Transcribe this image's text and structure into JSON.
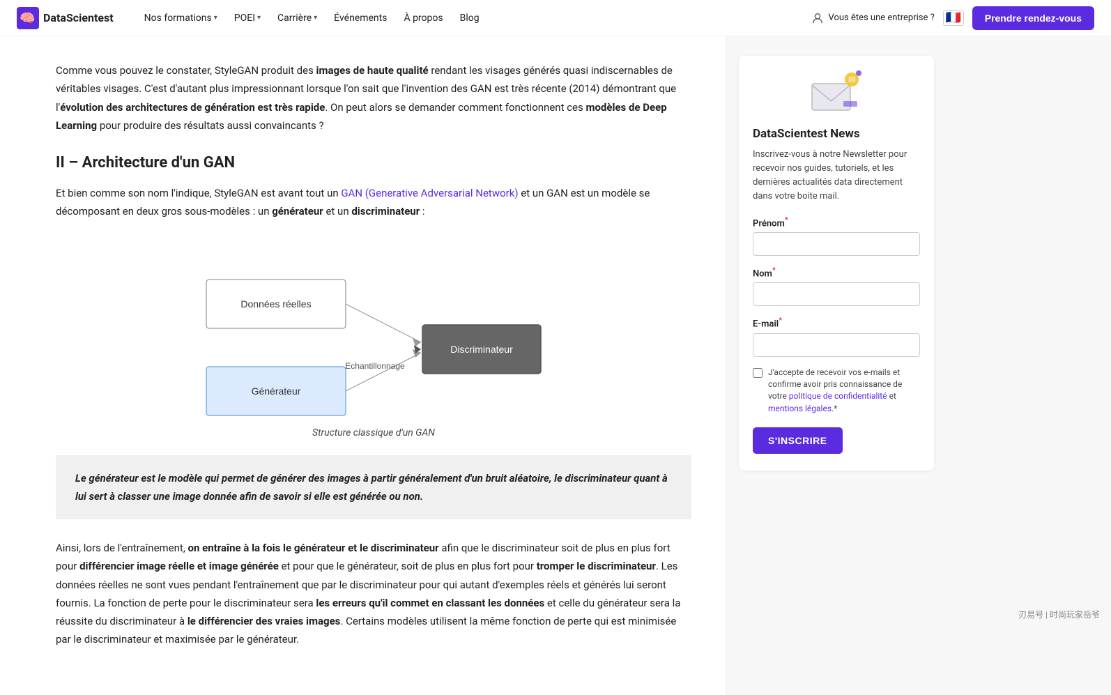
{
  "navbar": {
    "logo_text": "DataScientest",
    "nav_items": [
      {
        "label": "Nos formations",
        "has_dropdown": true
      },
      {
        "label": "POEI",
        "has_dropdown": true
      },
      {
        "label": "Carrière",
        "has_dropdown": true
      },
      {
        "label": "Événements",
        "has_dropdown": false
      },
      {
        "label": "À propos",
        "has_dropdown": false
      },
      {
        "label": "Blog",
        "has_dropdown": false
      }
    ],
    "enterprise_label": "Vous êtes une entreprise ?",
    "flag_emoji": "🇫🇷",
    "cta_label": "Prendre rendez-vous"
  },
  "main": {
    "intro_paragraph": "Comme vous pouvez le constater, StyleGAN produit des images de haute qualité rendant les visages générés quasi indiscernables de véritables visages. C'est d'autant plus impressionnant lorsque l'on sait que l'invention des GAN est très récente (2014) démontrant que l'évolution des architectures de génération est très rapide. On peut alors se demander comment fonctionnent ces modèles de Deep Learning pour produire des résultats aussi convaincants ?",
    "section_heading": "II – Architecture d'un GAN",
    "section_intro_plain": "Et bien comme son nom l'indique, StyleGAN est avant tout un ",
    "section_intro_link_text": "GAN (Generative Adversarial Network)",
    "section_intro_link_href": "#",
    "section_intro_end": " et un GAN est un modèle se décomposant en deux gros sous-modèles : un générateur et un discriminateur :",
    "diagram": {
      "caption": "Structure classique d'un GAN",
      "box_donnees": "Données réelles",
      "box_generateur": "Générateur",
      "box_discriminateur": "Discriminateur",
      "label_echantillonnage": "Echantillonnage"
    },
    "quote_text": "Le générateur est le modèle qui permet de générer des images à partir généralement d'un bruit aléatoire, le discriminateur quant à lui sert à classer une image donnée afin de savoir si elle est générée ou non.",
    "body_paragraph_1_start": "Ainsi, lors de l'entraînement, ",
    "body_paragraph_1_bold1": "on entraîne à la fois le générateur et le discriminateur",
    "body_paragraph_1_mid": " afin que le discriminateur soit de plus en plus fort pour ",
    "body_paragraph_1_bold2": "différencier image réelle et image générée",
    "body_paragraph_1_mid2": " et pour que le générateur, soit de plus en plus fort pour ",
    "body_paragraph_1_bold3": "tromper le discriminateur",
    "body_paragraph_1_end": ". Les données réelles ne sont vues pendant l'entraînement que par le discriminateur pour qui autant d'exemples réels et générés lui seront fournis. La fonction de perte pour le discriminateur sera ",
    "body_paragraph_1_bold4": "les erreurs qu'il commet en classant les données",
    "body_paragraph_1_mid3": " et celle du générateur sera la réussite du discriminateur à ",
    "body_paragraph_1_bold5": "le différencier des vraies images",
    "body_paragraph_1_end2": ". Certains modèles utilisent la même fonction de perte qui est minimisée par le discriminateur et maximisée par le générateur."
  },
  "sidebar": {
    "newsletter": {
      "title": "DataScientest News",
      "description": "Inscrivez-vous à notre Newsletter pour recevoir nos guides, tutoriels, et les dernières actualités data directement dans votre boite mail.",
      "prenom_label": "Prénom",
      "prenom_required": true,
      "nom_label": "Nom",
      "nom_required": true,
      "email_label": "E-mail",
      "email_required": true,
      "checkbox_text": "J'accepte de recevoir vos e-mails et confirme avoir pris connaissance de votre politique de confidentialité et mentions légales.",
      "checkbox_required": true,
      "subscribe_button": "S'INSCRIRE"
    }
  },
  "bottom_brand": "刃易号 | 时尚玩家岳爷"
}
